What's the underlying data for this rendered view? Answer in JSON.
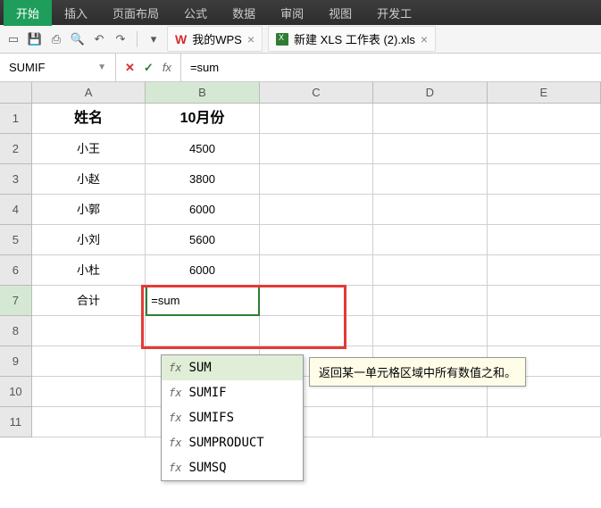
{
  "ribbon": {
    "tabs": [
      "开始",
      "插入",
      "页面布局",
      "公式",
      "数据",
      "审阅",
      "视图",
      "开发工"
    ]
  },
  "docTabs": {
    "t1": {
      "label": "我的WPS"
    },
    "t2": {
      "label": "新建 XLS 工作表 (2).xls"
    }
  },
  "nameBox": {
    "value": "SUMIF"
  },
  "formulaBar": {
    "value": "=sum"
  },
  "columns": [
    "A",
    "B",
    "C",
    "D",
    "E"
  ],
  "rows": {
    "r1": {
      "A": "姓名",
      "B": "10月份"
    },
    "r2": {
      "A": "小王",
      "B": "4500"
    },
    "r3": {
      "A": "小赵",
      "B": "3800"
    },
    "r4": {
      "A": "小郭",
      "B": "6000"
    },
    "r5": {
      "A": "小刘",
      "B": "5600"
    },
    "r6": {
      "A": "小杜",
      "B": "6000"
    },
    "r7": {
      "A": "合计",
      "B": "=sum"
    }
  },
  "autocomplete": {
    "items": [
      "SUM",
      "SUMIF",
      "SUMIFS",
      "SUMPRODUCT",
      "SUMSQ"
    ],
    "selectedIndex": 0
  },
  "tooltip": {
    "text": "返回某一单元格区域中所有数值之和。"
  }
}
